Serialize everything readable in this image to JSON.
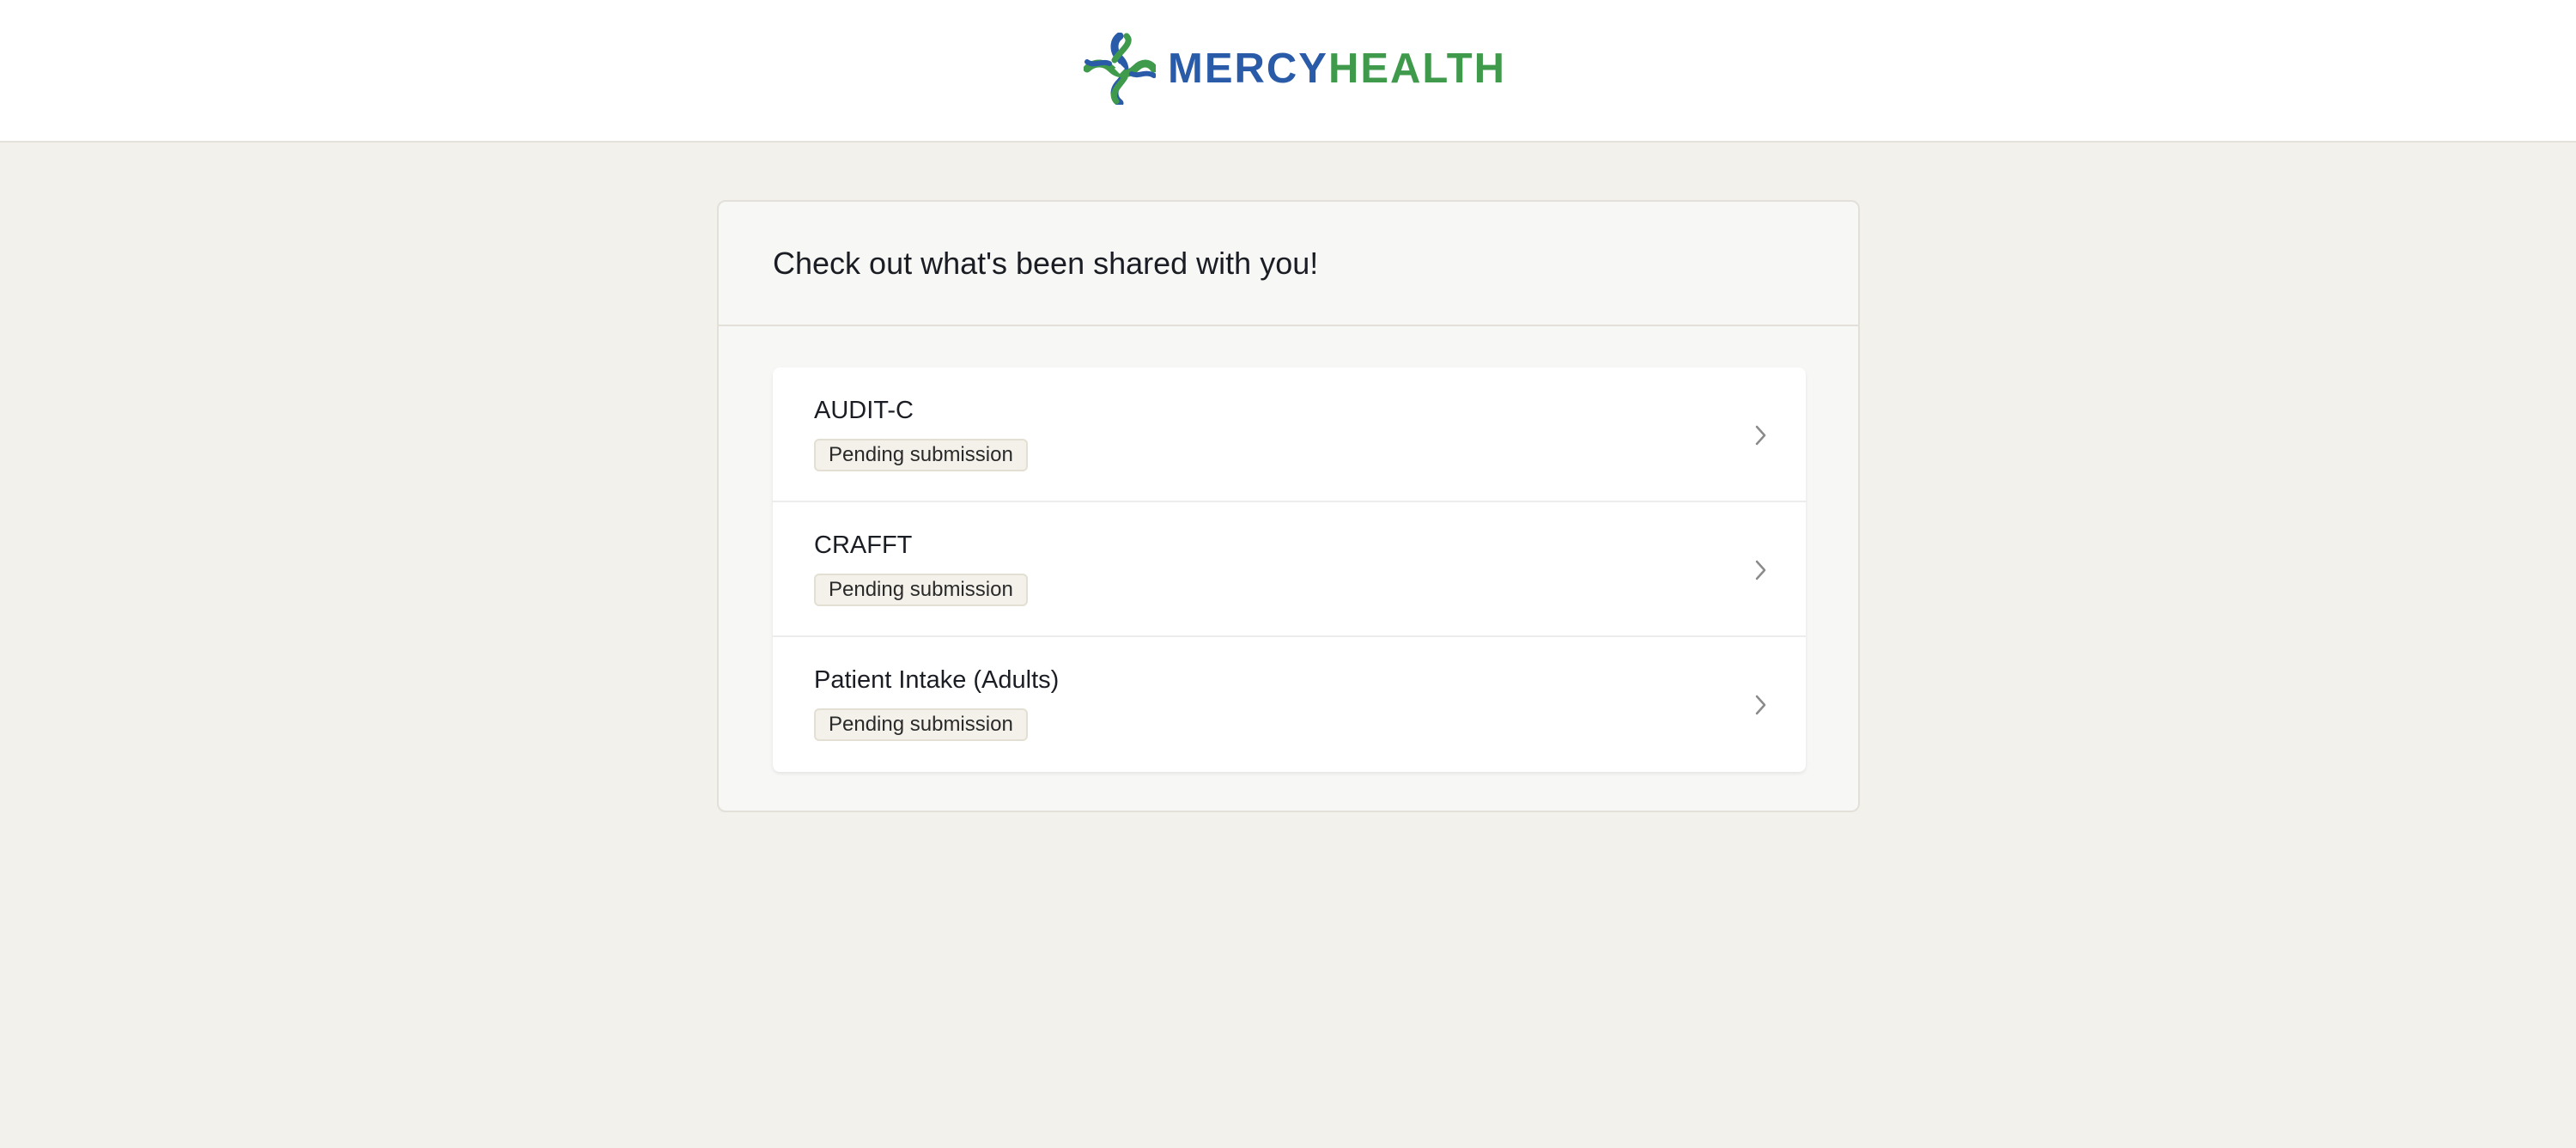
{
  "header": {
    "logo": {
      "text_part1": "MERCY",
      "text_part2": "HEALTH",
      "colors": {
        "blue": "#2a5ba8",
        "green": "#3f9a4c"
      }
    }
  },
  "main": {
    "title": "Check out what's been shared with you!",
    "items": [
      {
        "name": "AUDIT-C",
        "status": "Pending submission",
        "icon": "chevron-right-icon"
      },
      {
        "name": "CRAFFT",
        "status": "Pending submission",
        "icon": "chevron-right-icon"
      },
      {
        "name": "Patient Intake (Adults)",
        "status": "Pending submission",
        "icon": "chevron-right-icon"
      }
    ]
  },
  "colors": {
    "page_background": "#f2f1eb",
    "panel_background": "#f7f7f5",
    "badge_background": "#f3f1ea",
    "text": "#1b1d24"
  }
}
